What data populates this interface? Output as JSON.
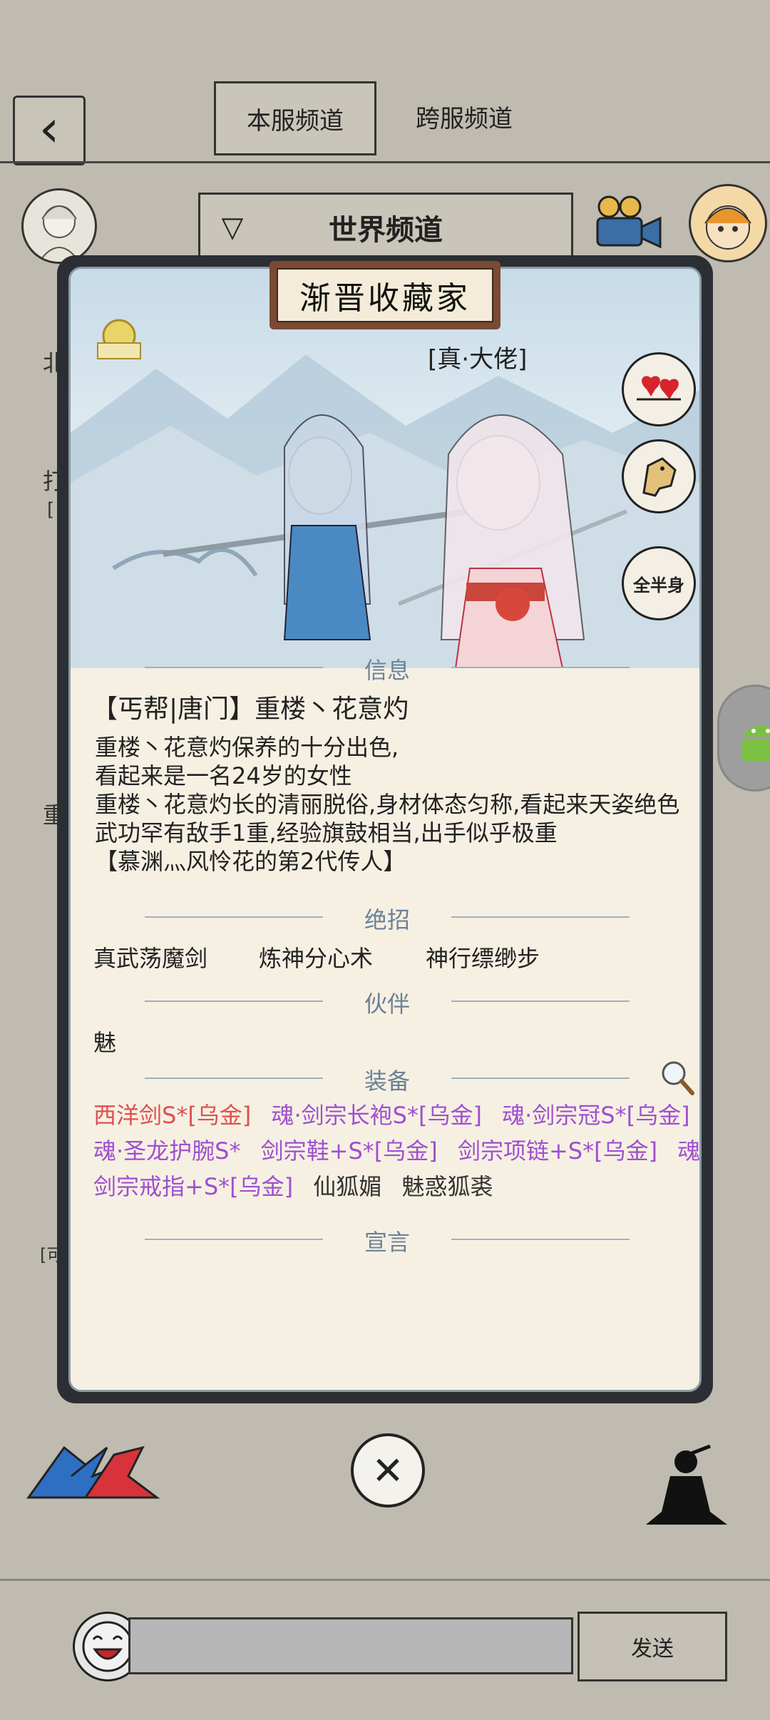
{
  "header": {
    "back_icon": "back-chevron-icon",
    "tabs": [
      {
        "label": "本服频道",
        "active": true
      },
      {
        "label": "跨服频道",
        "active": false
      }
    ]
  },
  "channel": {
    "selected": "世界频道",
    "dropdown_icon": "triangle-down-icon"
  },
  "background_peek": {
    "left_chars": [
      "北",
      "打",
      "[",
      "重",
      "[可"
    ]
  },
  "profile": {
    "title": "渐晋收藏家",
    "rank": "[真·大佬]",
    "side_buttons": [
      "hearts-icon",
      "horse-icon",
      "full-half-body-icon"
    ],
    "side_button_text": "全半身",
    "sections": {
      "info": "信息",
      "skills": "绝招",
      "partner": "伙伴",
      "equipment": "装备",
      "declaration": "宣言"
    },
    "name_line": "【丐帮|唐门】重楼丶花意灼",
    "info_lines": [
      "重楼丶花意灼保养的十分出色,",
      "看起来是一名24岁的女性",
      "重楼丶花意灼长的清丽脱俗,身材体态匀称,看起来天姿绝色",
      "武功罕有敌手1重,经验旗鼓相当,出手似乎极重",
      "【慕渊灬风怜花的第2代传人】"
    ],
    "skills": [
      "真武荡魔剑",
      "炼神分心术",
      "神行缥缈步"
    ],
    "partner": "魅",
    "equipment_lines": [
      [
        {
          "text": "西洋剑S*[乌金]",
          "color": "#e0504e"
        },
        {
          "text": "魂·剑宗长袍S*[乌金]",
          "color": "#9f4fd0"
        },
        {
          "text": "魂·剑宗冠S*[乌金]",
          "color": "#9f4fd0"
        }
      ],
      [
        {
          "text": "魂·圣龙护腕S*",
          "color": "#9f4fd0"
        },
        {
          "text": "剑宗鞋+S*[乌金]",
          "color": "#9f4fd0"
        },
        {
          "text": "剑宗项链+S*[乌金]",
          "color": "#9f4fd0"
        },
        {
          "text": "魂·",
          "color": "#9f4fd0"
        }
      ],
      [
        {
          "text": "剑宗戒指+S*[乌金]",
          "color": "#9f4fd0"
        },
        {
          "text": "仙狐媚",
          "color": "#333333"
        },
        {
          "text": "魅惑狐裘",
          "color": "#333333"
        }
      ]
    ],
    "magnifier_icon": "magnifier-icon"
  },
  "bottom_bar": {
    "left_icon": "crossed-fighters-icon",
    "close_icon": "close-x-icon",
    "right_icon": "meditating-figure-icon",
    "emoji_icon": "laughing-face-icon",
    "input_placeholder": "",
    "send_label": "发送"
  },
  "overlay": {
    "floating_icon": "android-robot-icon"
  },
  "colors": {
    "background": "#bfbbb0",
    "panel": "#f6f0e3",
    "section_heading": "#6c8296",
    "equip_red": "#e0504e",
    "equip_purple": "#9f4fd0"
  }
}
